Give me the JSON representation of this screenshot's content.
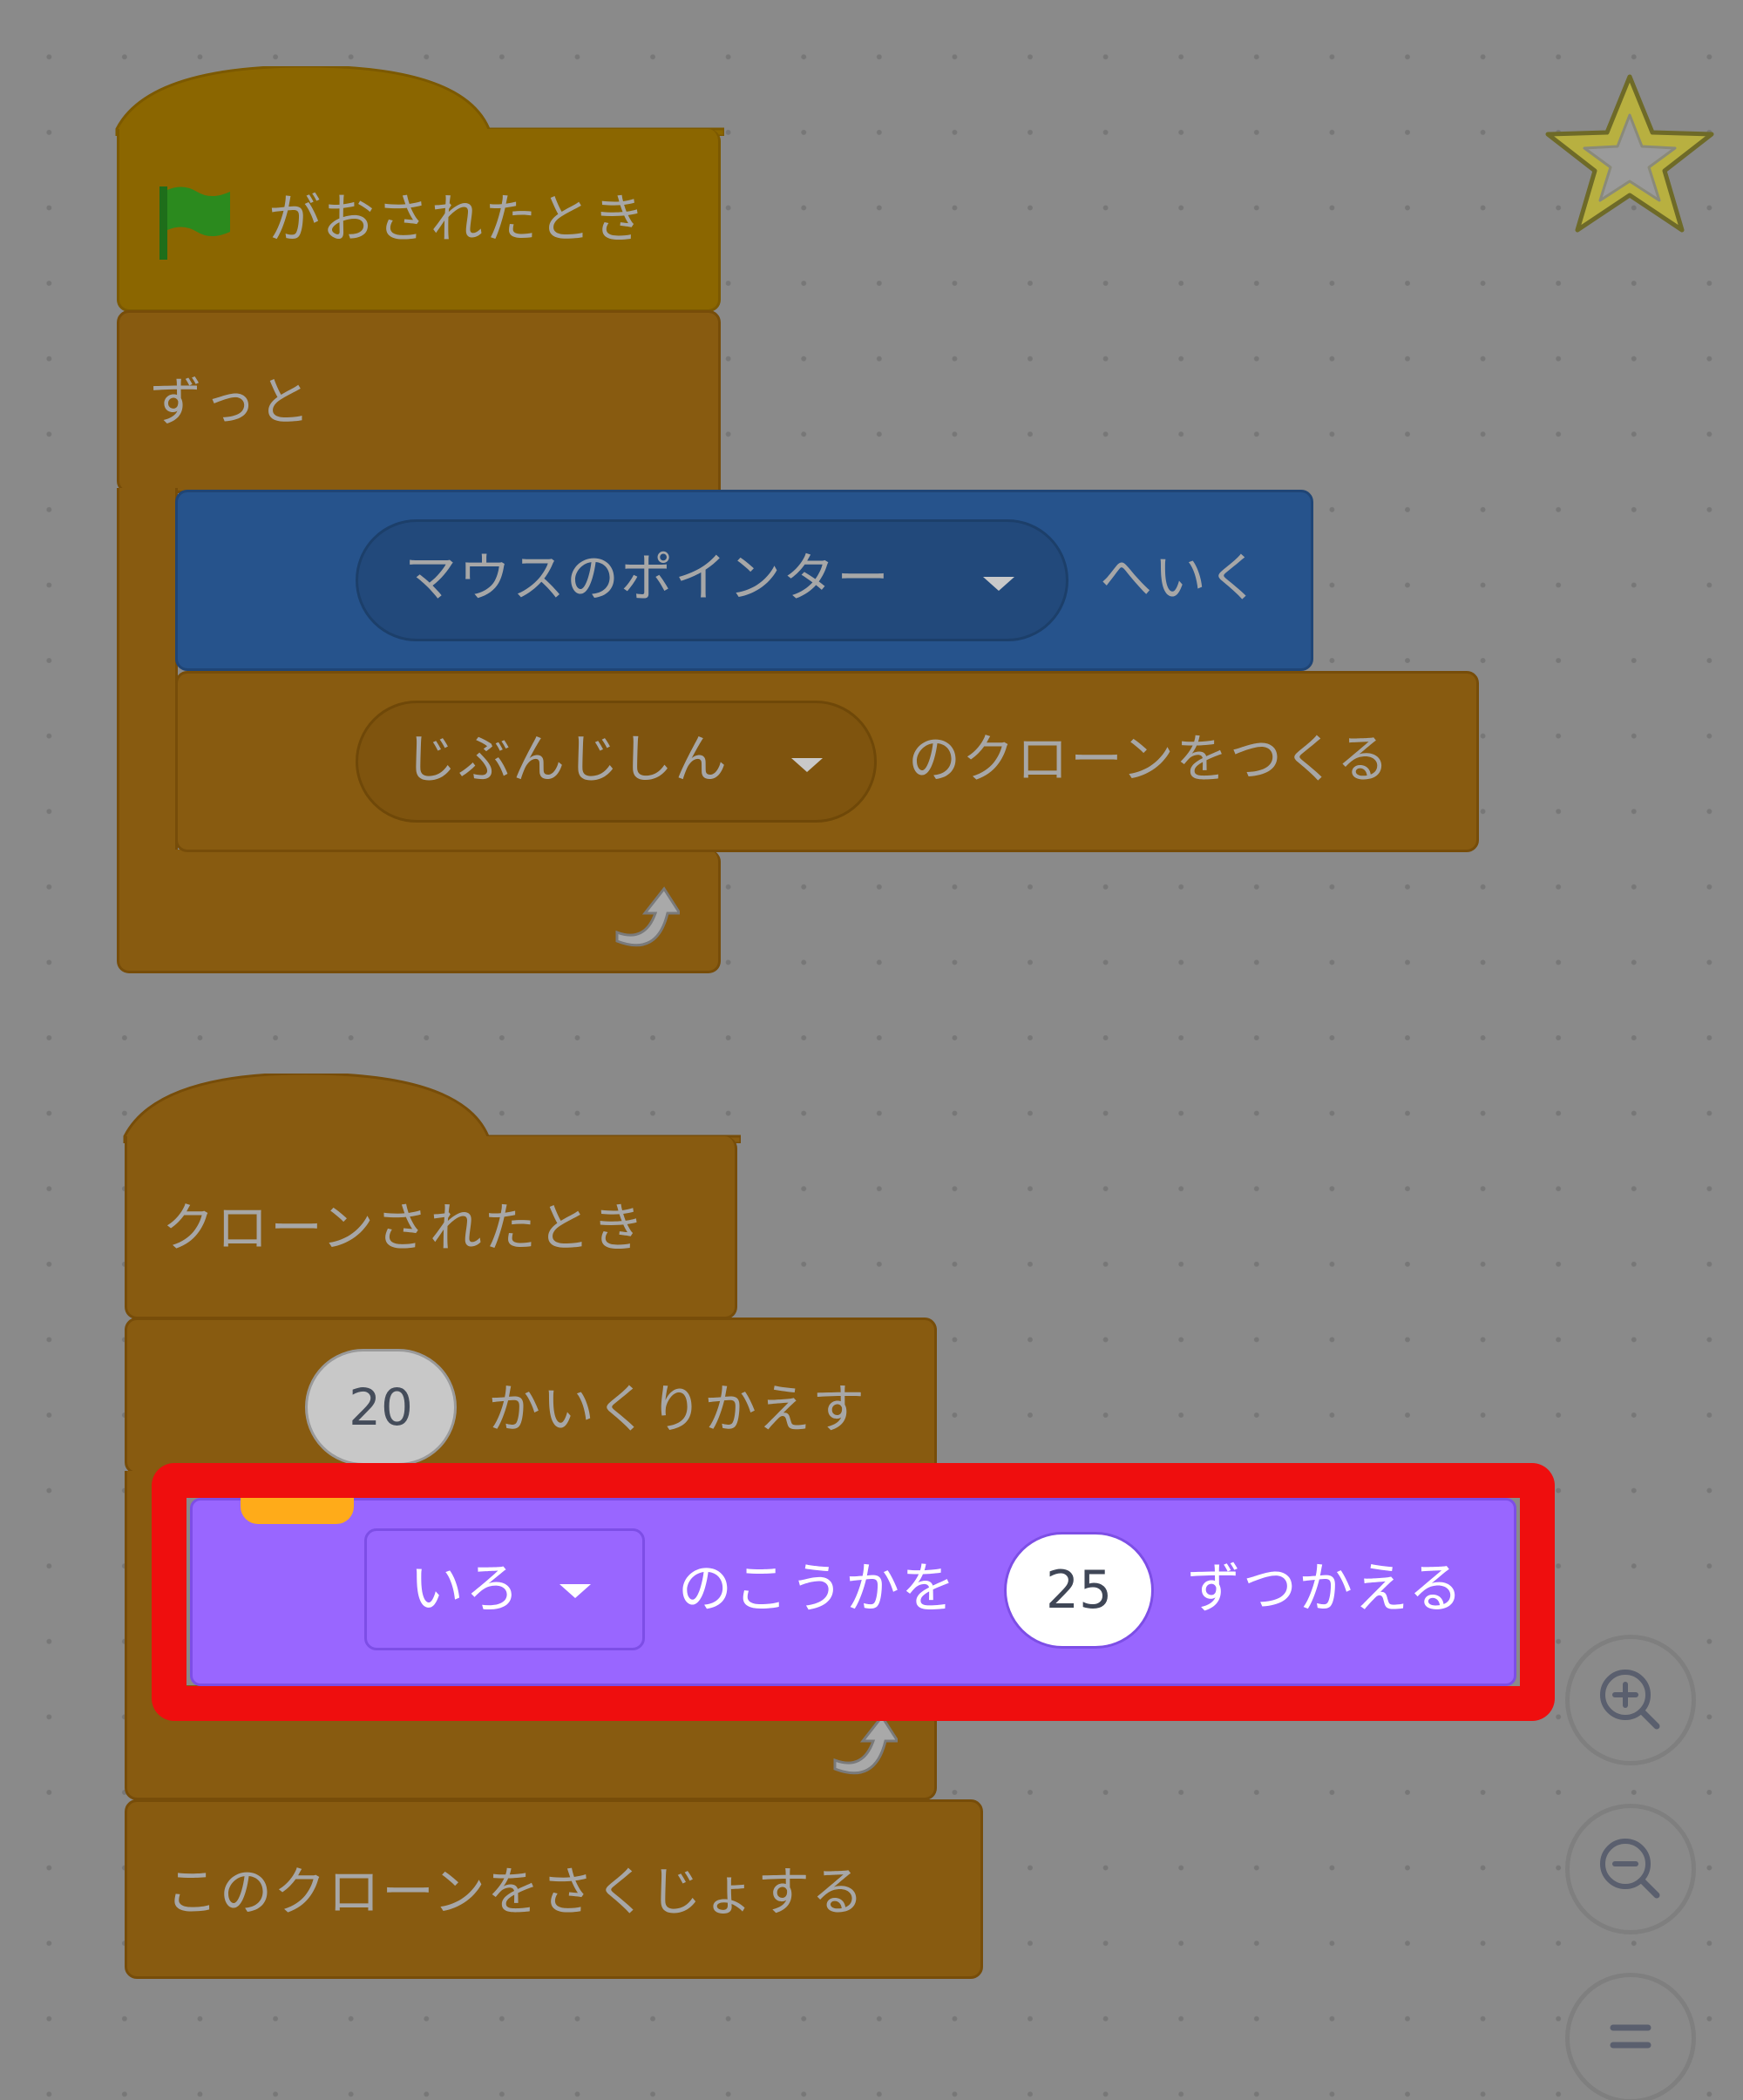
{
  "script_green_flag": {
    "hat_label": "がおされたとき",
    "forever_label": "ずっと",
    "goto_menu_value": "マウスのポインター",
    "goto_suffix": "へいく",
    "clone_menu_value": "じぶんじしん",
    "clone_suffix": "のクローンをつくる"
  },
  "script_clone": {
    "hat_label": "クローンされたとき",
    "repeat_count": "20",
    "repeat_suffix": "かいくりかえす",
    "effect_menu_value": "いろ",
    "effect_middle": "のこうかを",
    "effect_amount": "25",
    "effect_suffix": "ずつかえる",
    "delete_label": "このクローンをさくじょする"
  },
  "colors": {
    "highlight": "#ef0e0e",
    "looks": "#9966ff",
    "canvas": "#8a8a8a"
  },
  "icons": [
    "green-flag-icon",
    "loop-arrow-icon",
    "star-sprite-icon",
    "zoom-in-icon",
    "zoom-out-icon",
    "zoom-reset-icon"
  ]
}
